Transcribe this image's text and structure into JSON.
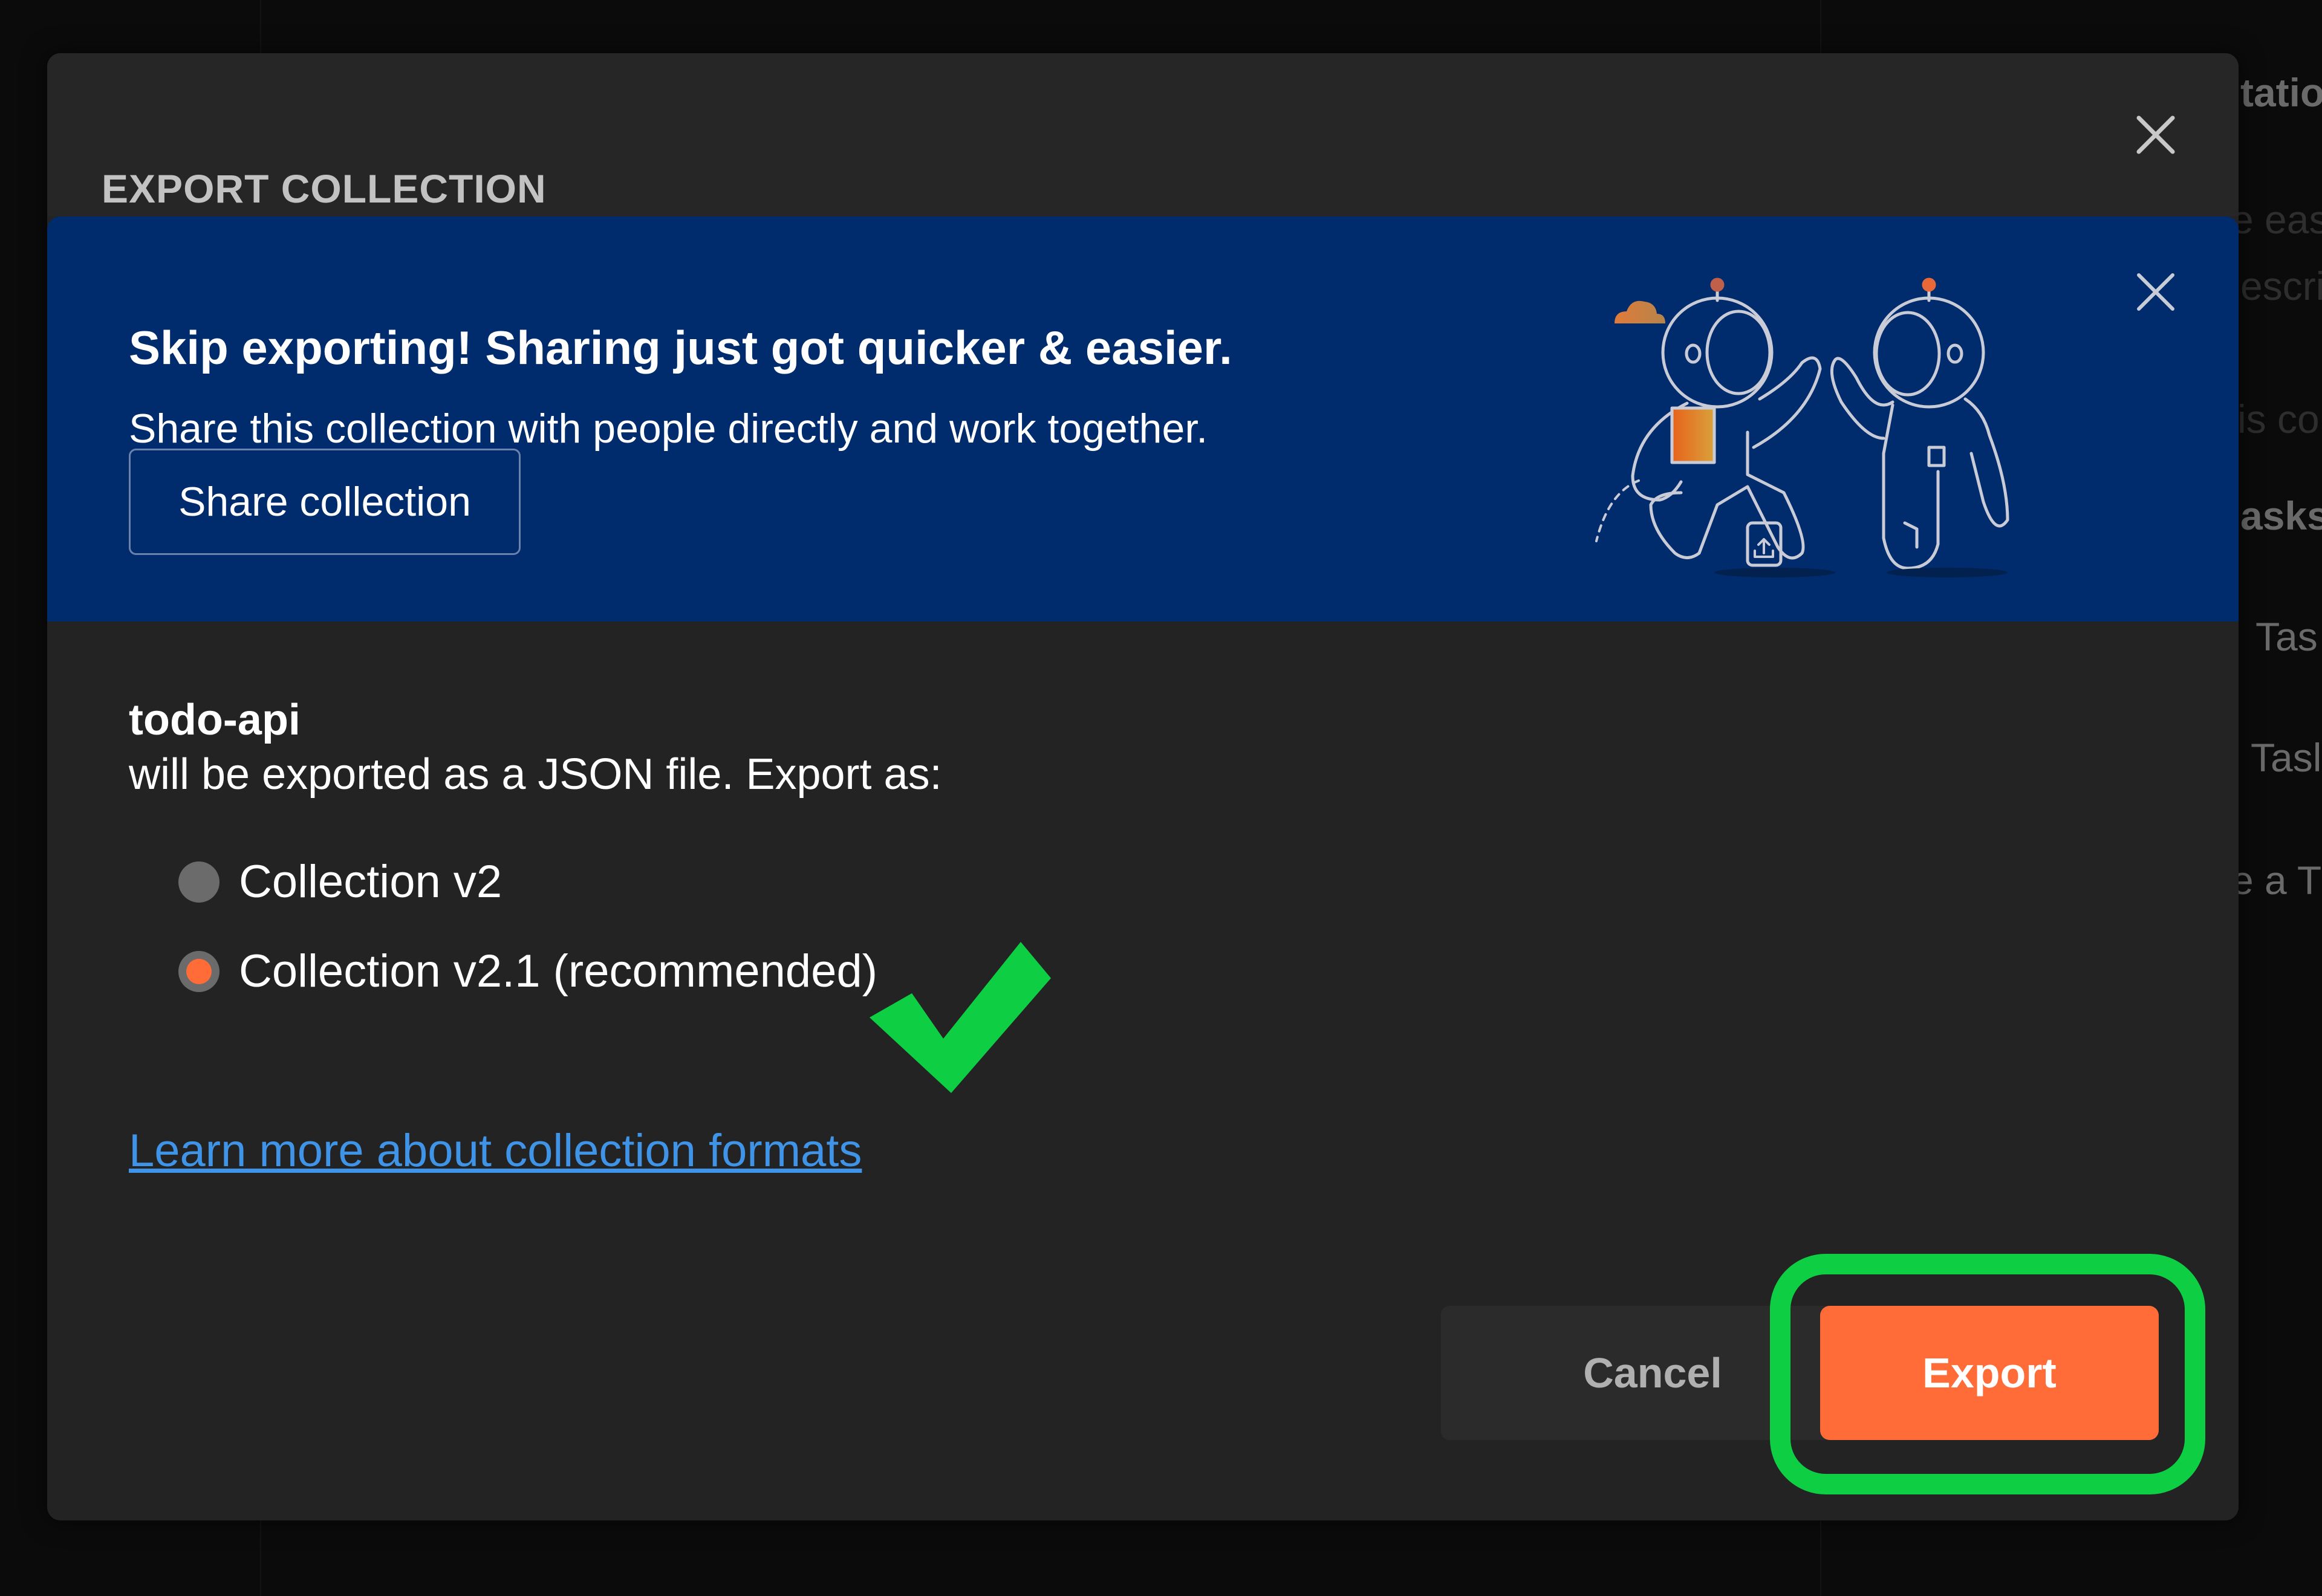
{
  "background": {
    "snippets": [
      {
        "text": "tatio",
        "style": "bold"
      },
      {
        "text": "e eas",
        "style": "dim"
      },
      {
        "text": "escri",
        "style": "dim"
      },
      {
        "text": "is co",
        "style": "dim"
      },
      {
        "text": "asks",
        "style": "bold"
      },
      {
        "text": "Tas",
        "style": "normal"
      },
      {
        "text": "Tasl",
        "style": "normal"
      },
      {
        "text": "e a T",
        "style": "normal"
      }
    ]
  },
  "modal": {
    "title": "EXPORT COLLECTION",
    "close_icon": "close-icon",
    "banner": {
      "title": "Skip exporting! Sharing just got quicker & easier.",
      "subtitle": "Share this collection with people directly and work together.",
      "share_button": "Share collection",
      "illustration": "astronauts-high-five-illustration",
      "close_icon": "close-icon"
    },
    "collection_name": "todo-api",
    "description": "will be exported as a JSON file. Export as:",
    "options": [
      {
        "label": "Collection v2",
        "selected": false
      },
      {
        "label": "Collection v2.1 (recommended)",
        "selected": true
      }
    ],
    "learn_more_link": "Learn more about collection formats",
    "cancel_button": "Cancel",
    "export_button": "Export"
  },
  "annotations": {
    "checkmark_color": "#0ecf44",
    "highlight_color": "#0ecf44"
  },
  "colors": {
    "accent": "#ff6c37",
    "banner": "#002b6d",
    "modal": "#232323",
    "link": "#3f94e8"
  }
}
